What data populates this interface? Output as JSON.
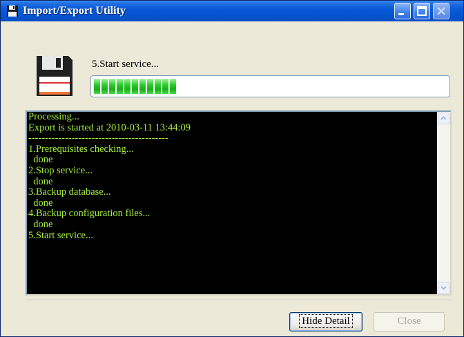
{
  "window": {
    "title": "Import/Export Utility",
    "title_icon": "floppy-disk-icon",
    "controls": [
      "minimize-icon",
      "maximize-icon",
      "close-icon"
    ]
  },
  "status": {
    "label": "5.Start service...",
    "progress_segments": 11,
    "icon": "floppy-disk-icon"
  },
  "log": {
    "lines": [
      "Processing...",
      "Export is started at 2010-03-11 13:44:09",
      "------------------------------------------",
      "1.Prerequisites checking...",
      "  done",
      "2.Stop service...",
      "  done",
      "3.Backup database...",
      "  done",
      "4.Backup configuration files...",
      "  done",
      "5.Start service..."
    ]
  },
  "buttons": {
    "hide_detail": "Hide Detail",
    "close": "Close"
  },
  "colors": {
    "log_text": "#a6f03c",
    "log_background": "#000000",
    "progress": "#2ecc2e",
    "titlebar": "#0a5ad8"
  }
}
